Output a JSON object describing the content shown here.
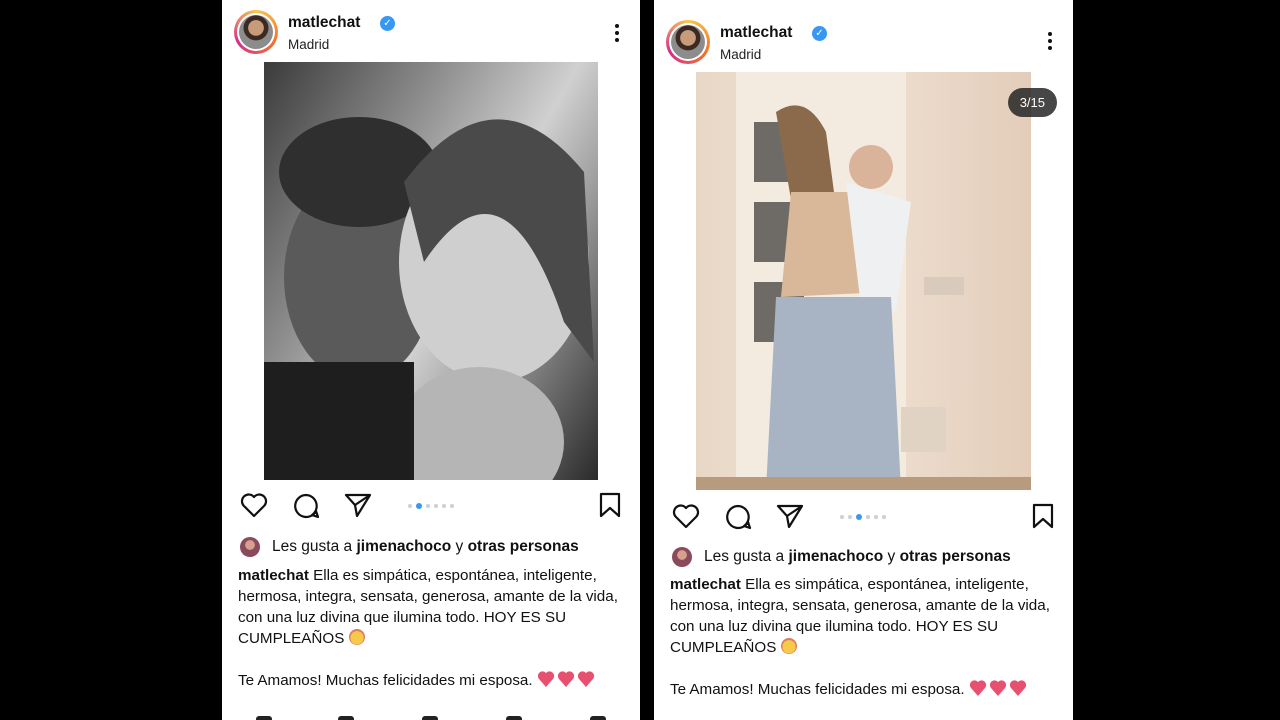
{
  "posts": [
    {
      "username": "matlechat",
      "verified": true,
      "location": "Madrid",
      "photo_label": "",
      "carousel_dots": 6,
      "active_dot": 1,
      "likes_prefix": "Les gusta a ",
      "likes_user": "jimenachoco",
      "likes_suffix": " y ",
      "likes_others": "otras personas",
      "caption_user": "matlechat",
      "caption_text": " Ella es simpática, espontánea, inteligente, hermosa, integra, sensata, generosa, amante de la vida, con una luz divina que ilumina todo. HOY ES SU CUMPLEAÑOS",
      "caption_line2": "Te Amamos! Muchas felicidades mi esposa."
    },
    {
      "username": "matlechat",
      "verified": true,
      "location": "Madrid",
      "photo_counter": "3/15",
      "carousel_dots": 6,
      "active_dot": 2,
      "likes_prefix": "Les gusta a ",
      "likes_user": "jimenachoco",
      "likes_suffix": " y ",
      "likes_others": "otras personas",
      "caption_user": "matlechat",
      "caption_text": " Ella es simpática, espontánea, inteligente, hermosa, integra, sensata, generosa, amante de la vida, con una luz divina que ilumina todo. HOY ES SU CUMPLEAÑOS",
      "caption_line2": "Te Amamos! Muchas felicidades mi esposa."
    }
  ],
  "colors": {
    "verified": "#3897f0",
    "active_dot": "#3897f0",
    "heart_emoji": "#e8506f"
  },
  "icons": [
    "heart-icon",
    "comment-icon",
    "share-icon",
    "bookmark-icon",
    "more-options-icon",
    "verified-badge-icon"
  ]
}
